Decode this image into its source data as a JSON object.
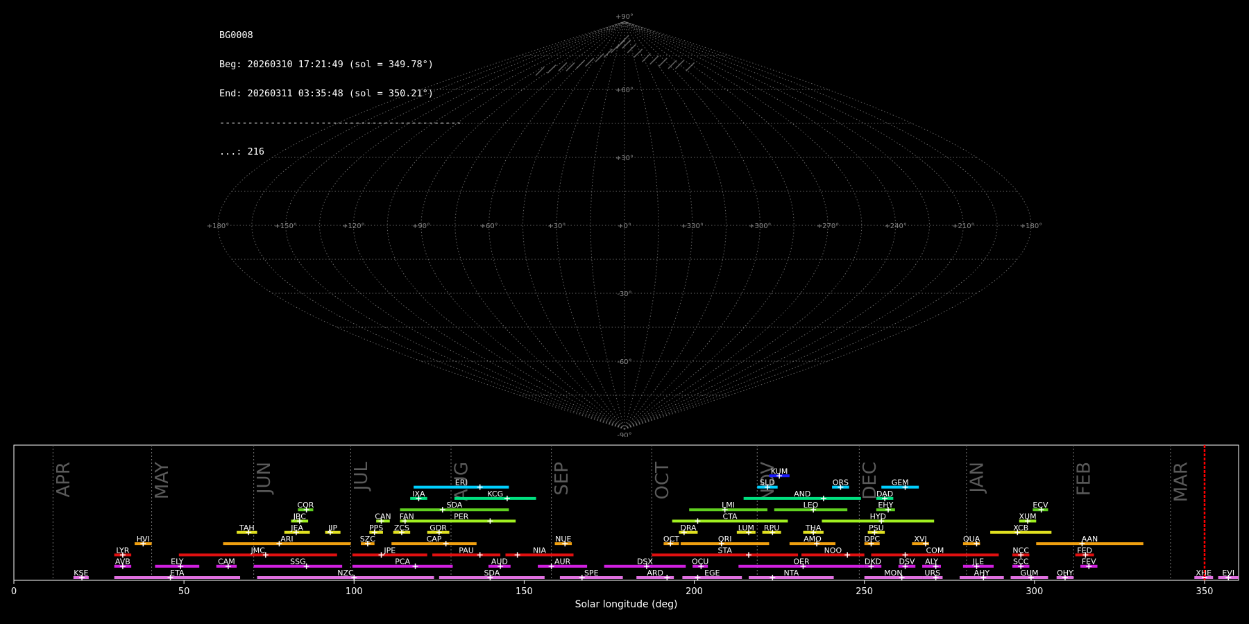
{
  "info": {
    "id": "BG0008",
    "begin": "Beg: 20260310 17:21:49 (sol = 349.78°)",
    "end": "End: 20260311 03:35:48 (sol = 350.21°)",
    "separator": "-------------------------------------------",
    "count": "...: 216"
  },
  "colors": {
    "background": "#000000",
    "grid": "#808080",
    "marker": "#ff0000"
  },
  "chart_data": [
    {
      "type": "scatter",
      "projection": "sinusoidal sky map",
      "lon_ticks": [
        "+180°",
        "+150°",
        "+120°",
        "+90°",
        "+60°",
        "+30°",
        "+0°",
        "+330°",
        "+300°",
        "+270°",
        "+240°",
        "+210°",
        "+180°"
      ],
      "lat_ticks": [
        "+90°",
        "+60°",
        "+30°",
        "-30°",
        "-60°",
        "-90°"
      ],
      "points_note": "",
      "points": [
        {
          "lon": 0,
          "lat": 82
        },
        {
          "lon": 5,
          "lat": 80
        },
        {
          "lon": 15,
          "lat": 78
        },
        {
          "lon": 25,
          "lat": 76
        },
        {
          "lon": 35,
          "lat": 74
        },
        {
          "lon": 45,
          "lat": 73
        },
        {
          "lon": 55,
          "lat": 72
        },
        {
          "lon": 65,
          "lat": 71
        },
        {
          "lon": 75,
          "lat": 71
        },
        {
          "lon": 85,
          "lat": 70
        },
        {
          "lon": -10,
          "lat": 80
        },
        {
          "lon": -20,
          "lat": 78
        },
        {
          "lon": -30,
          "lat": 76
        },
        {
          "lon": -40,
          "lat": 74
        },
        {
          "lon": -50,
          "lat": 72
        },
        {
          "lon": -60,
          "lat": 71
        },
        {
          "lon": -70,
          "lat": 70
        },
        {
          "lon": -80,
          "lat": 70
        },
        {
          "lon": -90,
          "lat": 69
        },
        {
          "lon": -100,
          "lat": 68
        }
      ]
    },
    {
      "type": "timeline",
      "xlabel": "Solar longitude (deg)",
      "xlim": [
        0,
        360
      ],
      "xticks": [
        0,
        50,
        100,
        150,
        200,
        250,
        300,
        350
      ],
      "current_sol": 350,
      "months": [
        {
          "name": "APR",
          "start": 11.5
        },
        {
          "name": "MAY",
          "start": 40.5
        },
        {
          "name": "JUN",
          "start": 70.5
        },
        {
          "name": "JUL",
          "start": 99
        },
        {
          "name": "AUG",
          "start": 128.5
        },
        {
          "name": "SEP",
          "start": 158
        },
        {
          "name": "OCT",
          "start": 187.5
        },
        {
          "name": "NOV",
          "start": 218.5
        },
        {
          "name": "DEC",
          "start": 248.5
        },
        {
          "name": "JAN",
          "start": 280
        },
        {
          "name": "FEB",
          "start": 311.5
        },
        {
          "name": "MAR",
          "start": 340
        }
      ],
      "showers": [
        {
          "code": "KUM",
          "start": 222,
          "end": 228,
          "peak": 225,
          "row": 9,
          "color": "#1a1aff"
        },
        {
          "code": "ERI",
          "start": 117.5,
          "end": 145.5,
          "peak": 137,
          "row": 8,
          "color": "#00d0ff"
        },
        {
          "code": "SLD",
          "start": 218.5,
          "end": 224.5,
          "peak": 221.5,
          "row": 8,
          "color": "#00d0ff"
        },
        {
          "code": "ORS",
          "start": 240.5,
          "end": 245.5,
          "peak": 243,
          "row": 8,
          "color": "#00d0ff"
        },
        {
          "code": "GEM",
          "start": 255,
          "end": 266,
          "peak": 262,
          "row": 8,
          "color": "#00d0ff"
        },
        {
          "code": "IXA",
          "start": 116.5,
          "end": 121.5,
          "peak": 119,
          "row": 7,
          "color": "#00e080"
        },
        {
          "code": "KCG",
          "start": 129.5,
          "end": 153.5,
          "peak": 145,
          "row": 7,
          "color": "#00e080"
        },
        {
          "code": "AND",
          "start": 214.5,
          "end": 249,
          "peak": 238,
          "row": 7,
          "color": "#00e080"
        },
        {
          "code": "DAD",
          "start": 253.5,
          "end": 258.5,
          "peak": 256,
          "row": 7,
          "color": "#00e080"
        },
        {
          "code": "COR",
          "start": 83.5,
          "end": 88,
          "peak": 86,
          "row": 6,
          "color": "#60d020"
        },
        {
          "code": "SDA",
          "start": 113.5,
          "end": 145.5,
          "peak": 126,
          "row": 6,
          "color": "#60d020"
        },
        {
          "code": "LMI",
          "start": 198.5,
          "end": 221.5,
          "peak": 209,
          "row": 6,
          "color": "#60d020"
        },
        {
          "code": "LEO",
          "start": 223.5,
          "end": 245,
          "peak": 235,
          "row": 6,
          "color": "#60d020"
        },
        {
          "code": "EHY",
          "start": 253.5,
          "end": 259,
          "peak": 257,
          "row": 6,
          "color": "#60d020"
        },
        {
          "code": "ECV",
          "start": 299.5,
          "end": 304,
          "peak": 302,
          "row": 6,
          "color": "#60d020"
        },
        {
          "code": "JBC",
          "start": 81.5,
          "end": 86.5,
          "peak": 84,
          "row": 5,
          "color": "#a0f020"
        },
        {
          "code": "CAN",
          "start": 106.5,
          "end": 110.5,
          "peak": 108,
          "row": 5,
          "color": "#a0f020"
        },
        {
          "code": "FAN",
          "start": 113.5,
          "end": 117.5,
          "peak": 115,
          "row": 5,
          "color": "#a0f020"
        },
        {
          "code": "PER",
          "start": 115.5,
          "end": 147.5,
          "peak": 140,
          "row": 5,
          "color": "#a0f020"
        },
        {
          "code": "CTA",
          "start": 193.5,
          "end": 227.5,
          "peak": 201,
          "row": 5,
          "color": "#a0f020"
        },
        {
          "code": "HYD",
          "start": 237.5,
          "end": 270.5,
          "peak": 255,
          "row": 5,
          "color": "#a0f020"
        },
        {
          "code": "XUM",
          "start": 295.5,
          "end": 300.5,
          "peak": 298,
          "row": 5,
          "color": "#a0f020"
        },
        {
          "code": "TAH",
          "start": 65.5,
          "end": 71.5,
          "peak": 69,
          "row": 4,
          "color": "#e0e020"
        },
        {
          "code": "JEA",
          "start": 79.5,
          "end": 87,
          "peak": 83,
          "row": 4,
          "color": "#e0e020"
        },
        {
          "code": "JIP",
          "start": 91.5,
          "end": 96,
          "peak": 93,
          "row": 4,
          "color": "#e0e020"
        },
        {
          "code": "PPS",
          "start": 104.5,
          "end": 108.5,
          "peak": 106,
          "row": 4,
          "color": "#e0e020"
        },
        {
          "code": "ZCS",
          "start": 111.5,
          "end": 116.5,
          "peak": 114,
          "row": 4,
          "color": "#e0e020"
        },
        {
          "code": "GDR",
          "start": 121.5,
          "end": 128,
          "peak": 125,
          "row": 4,
          "color": "#e0e020"
        },
        {
          "code": "DRA",
          "start": 195.5,
          "end": 201,
          "peak": 197,
          "row": 4,
          "color": "#e0e020"
        },
        {
          "code": "LUM",
          "start": 212.5,
          "end": 218,
          "peak": 216,
          "row": 4,
          "color": "#e0e020"
        },
        {
          "code": "RPU",
          "start": 220,
          "end": 225.5,
          "peak": 223,
          "row": 4,
          "color": "#e0e020"
        },
        {
          "code": "THA",
          "start": 232,
          "end": 238,
          "peak": 235,
          "row": 4,
          "color": "#e0e020"
        },
        {
          "code": "PSU",
          "start": 251,
          "end": 256,
          "peak": 253,
          "row": 4,
          "color": "#e0e020"
        },
        {
          "code": "XCB",
          "start": 287,
          "end": 305,
          "peak": 295,
          "row": 4,
          "color": "#e0e020"
        },
        {
          "code": "HVI",
          "start": 35.5,
          "end": 40.5,
          "peak": 38,
          "row": 3,
          "color": "#f0a010"
        },
        {
          "code": "ARI",
          "start": 61.5,
          "end": 99,
          "peak": 78,
          "row": 3,
          "color": "#f0a010"
        },
        {
          "code": "SZC",
          "start": 102,
          "end": 106,
          "peak": 104,
          "row": 3,
          "color": "#f0a010"
        },
        {
          "code": "CAP",
          "start": 111,
          "end": 136,
          "peak": 127,
          "row": 3,
          "color": "#f0a010"
        },
        {
          "code": "NUE",
          "start": 159,
          "end": 164,
          "peak": 162,
          "row": 3,
          "color": "#f0a010"
        },
        {
          "code": "OCT",
          "start": 191,
          "end": 195.5,
          "peak": 193,
          "row": 3,
          "color": "#f0a010"
        },
        {
          "code": "ORI",
          "start": 196,
          "end": 222,
          "peak": 208,
          "row": 3,
          "color": "#f0a010"
        },
        {
          "code": "AMO",
          "start": 228,
          "end": 241.5,
          "peak": 236,
          "row": 3,
          "color": "#f0a010"
        },
        {
          "code": "DPC",
          "start": 250,
          "end": 254.5,
          "peak": 252,
          "row": 3,
          "color": "#f0a010"
        },
        {
          "code": "XVI",
          "start": 264,
          "end": 269,
          "peak": 268,
          "row": 3,
          "color": "#f0a010"
        },
        {
          "code": "QUA",
          "start": 279,
          "end": 284,
          "peak": 283,
          "row": 3,
          "color": "#f0a010"
        },
        {
          "code": "AAN",
          "start": 300.5,
          "end": 332,
          "peak": 314,
          "row": 3,
          "color": "#f0a010"
        },
        {
          "code": "LYR",
          "start": 29.5,
          "end": 34.5,
          "peak": 32,
          "row": 2,
          "color": "#e01010"
        },
        {
          "code": "JMC",
          "start": 48.5,
          "end": 95,
          "peak": 74,
          "row": 2,
          "color": "#e01010"
        },
        {
          "code": "JPE",
          "start": 99.5,
          "end": 121.5,
          "peak": 108,
          "row": 2,
          "color": "#e01010"
        },
        {
          "code": "PAU",
          "start": 123,
          "end": 143,
          "peak": 137,
          "row": 2,
          "color": "#e01010"
        },
        {
          "code": "NIA",
          "start": 144.5,
          "end": 164.5,
          "peak": 148,
          "row": 2,
          "color": "#e01010"
        },
        {
          "code": "STA",
          "start": 187.5,
          "end": 230.5,
          "peak": 216,
          "row": 2,
          "color": "#e01010"
        },
        {
          "code": "NOO",
          "start": 231.5,
          "end": 250,
          "peak": 245,
          "row": 2,
          "color": "#e01010"
        },
        {
          "code": "COM",
          "start": 252,
          "end": 289.5,
          "peak": 262,
          "row": 2,
          "color": "#e01010"
        },
        {
          "code": "NCC",
          "start": 293.5,
          "end": 298.5,
          "peak": 296,
          "row": 2,
          "color": "#e01010"
        },
        {
          "code": "FED",
          "start": 312,
          "end": 317.5,
          "peak": 315,
          "row": 2,
          "color": "#e01010"
        },
        {
          "code": "AVB",
          "start": 29.5,
          "end": 34.5,
          "peak": 32,
          "row": 1,
          "color": "#d020e0"
        },
        {
          "code": "ELY",
          "start": 41.5,
          "end": 54.5,
          "peak": 49,
          "row": 1,
          "color": "#d020e0"
        },
        {
          "code": "CAM",
          "start": 59.5,
          "end": 65.5,
          "peak": 63,
          "row": 1,
          "color": "#d020e0"
        },
        {
          "code": "SSG",
          "start": 70.5,
          "end": 96.5,
          "peak": 86,
          "row": 1,
          "color": "#d020e0"
        },
        {
          "code": "PCA",
          "start": 99.5,
          "end": 129,
          "peak": 118,
          "row": 1,
          "color": "#d020e0"
        },
        {
          "code": "AUD",
          "start": 139.5,
          "end": 146,
          "peak": 143,
          "row": 1,
          "color": "#d020e0"
        },
        {
          "code": "AUR",
          "start": 154,
          "end": 168.5,
          "peak": 158,
          "row": 1,
          "color": "#d020e0"
        },
        {
          "code": "DSX",
          "start": 173.5,
          "end": 197.5,
          "peak": 186,
          "row": 1,
          "color": "#d020e0"
        },
        {
          "code": "OCU",
          "start": 199.5,
          "end": 204,
          "peak": 202,
          "row": 1,
          "color": "#d020e0"
        },
        {
          "code": "OER",
          "start": 213,
          "end": 250,
          "peak": 232,
          "row": 1,
          "color": "#d020e0"
        },
        {
          "code": "DKD",
          "start": 250,
          "end": 255,
          "peak": 252,
          "row": 1,
          "color": "#d020e0"
        },
        {
          "code": "DSV",
          "start": 260,
          "end": 265,
          "peak": 262,
          "row": 1,
          "color": "#d020e0"
        },
        {
          "code": "ALY",
          "start": 267,
          "end": 272.5,
          "peak": 271,
          "row": 1,
          "color": "#d020e0"
        },
        {
          "code": "JLE",
          "start": 279,
          "end": 288,
          "peak": 283,
          "row": 1,
          "color": "#d020e0"
        },
        {
          "code": "SCC",
          "start": 293.5,
          "end": 298.5,
          "peak": 296,
          "row": 1,
          "color": "#d020e0"
        },
        {
          "code": "FEV",
          "start": 313.5,
          "end": 318.5,
          "peak": 316,
          "row": 1,
          "color": "#d020e0"
        },
        {
          "code": "KSE",
          "start": 17.5,
          "end": 22,
          "peak": 20,
          "row": 0,
          "color": "#e070e0"
        },
        {
          "code": "ETA",
          "start": 29.5,
          "end": 66.5,
          "peak": 46,
          "row": 0,
          "color": "#e070e0"
        },
        {
          "code": "NZC",
          "start": 71.5,
          "end": 123.5,
          "peak": 100,
          "row": 0,
          "color": "#e070e0"
        },
        {
          "code": "SDA",
          "start": 125,
          "end": 156,
          "peak": 140,
          "row": 0,
          "color": "#e070e0"
        },
        {
          "code": "SPE",
          "start": 160.5,
          "end": 179,
          "peak": 167,
          "row": 0,
          "color": "#e070e0"
        },
        {
          "code": "ARD",
          "start": 183,
          "end": 194,
          "peak": 192,
          "row": 0,
          "color": "#e070e0"
        },
        {
          "code": "EGE",
          "start": 196.5,
          "end": 214,
          "peak": 201,
          "row": 0,
          "color": "#e070e0"
        },
        {
          "code": "NTA",
          "start": 216,
          "end": 241,
          "peak": 223,
          "row": 0,
          "color": "#e070e0"
        },
        {
          "code": "MON",
          "start": 250,
          "end": 267,
          "peak": 261,
          "row": 0,
          "color": "#e070e0"
        },
        {
          "code": "URS",
          "start": 267,
          "end": 273,
          "peak": 271,
          "row": 0,
          "color": "#e070e0"
        },
        {
          "code": "AHY",
          "start": 278,
          "end": 291,
          "peak": 285,
          "row": 0,
          "color": "#e070e0"
        },
        {
          "code": "GUM",
          "start": 293,
          "end": 304,
          "peak": 299,
          "row": 0,
          "color": "#e070e0"
        },
        {
          "code": "OHY",
          "start": 306.5,
          "end": 311.5,
          "peak": 309,
          "row": 0,
          "color": "#e070e0"
        },
        {
          "code": "XHE",
          "start": 347,
          "end": 352.5,
          "peak": 350,
          "row": 0,
          "color": "#e070e0"
        },
        {
          "code": "EVI",
          "start": 354,
          "end": 360,
          "peak": 357,
          "row": 0,
          "color": "#e070e0"
        }
      ]
    }
  ]
}
